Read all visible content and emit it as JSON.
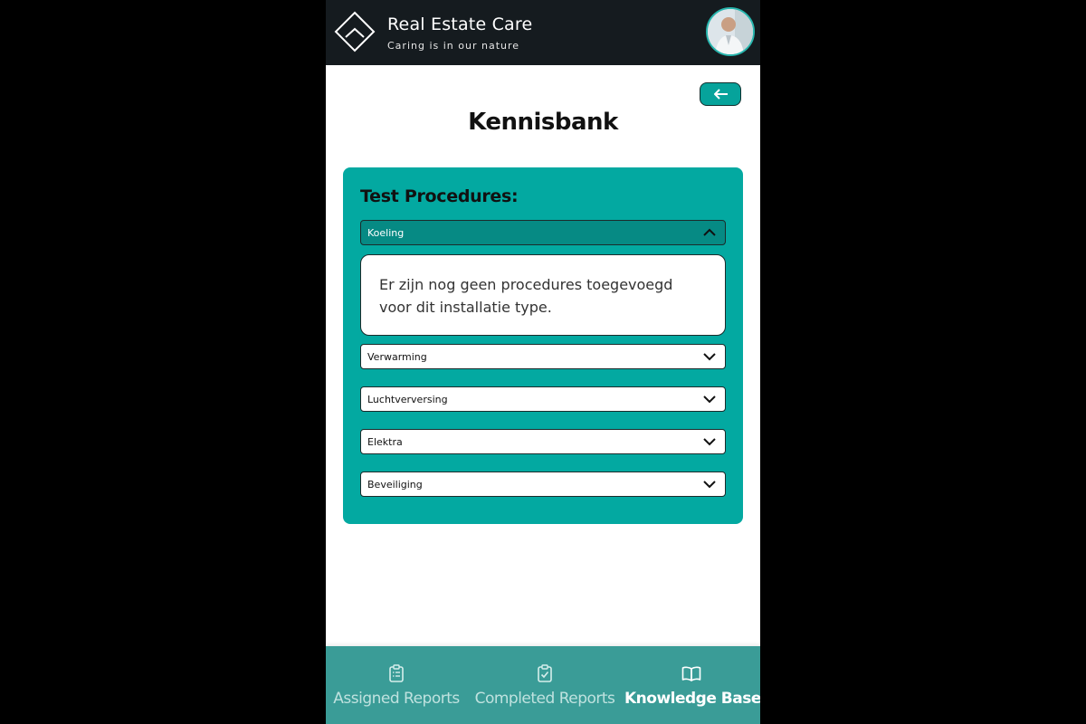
{
  "header": {
    "brand_title": "Real Estate Care",
    "brand_subtitle": "Caring is in our nature",
    "logo_icon": "diamond-logo-icon",
    "avatar_icon": "user-avatar"
  },
  "page": {
    "back_icon": "arrow-left-icon",
    "title": "Kennisbank"
  },
  "card": {
    "title": "Test Procedures:",
    "items": [
      {
        "label": "Koeling",
        "expanded": true,
        "content": "Er zijn nog geen procedures toegevoegd voor dit installatie type."
      },
      {
        "label": "Verwarming",
        "expanded": false
      },
      {
        "label": "Luchtverversing",
        "expanded": false
      },
      {
        "label": "Elektra",
        "expanded": false
      },
      {
        "label": "Beveiliging",
        "expanded": false
      }
    ]
  },
  "nav": {
    "items": [
      {
        "label": "Assigned Reports",
        "icon": "clipboard-list-icon",
        "active": false
      },
      {
        "label": "Completed Reports",
        "icon": "clipboard-check-icon",
        "active": false
      },
      {
        "label": "Knowledge Base",
        "icon": "open-book-icon",
        "active": true
      }
    ]
  },
  "colors": {
    "header_bg": "#151b1f",
    "accent": "#03a9a1",
    "accent_dark": "#068a84",
    "nav_bg": "#3a9c97"
  }
}
